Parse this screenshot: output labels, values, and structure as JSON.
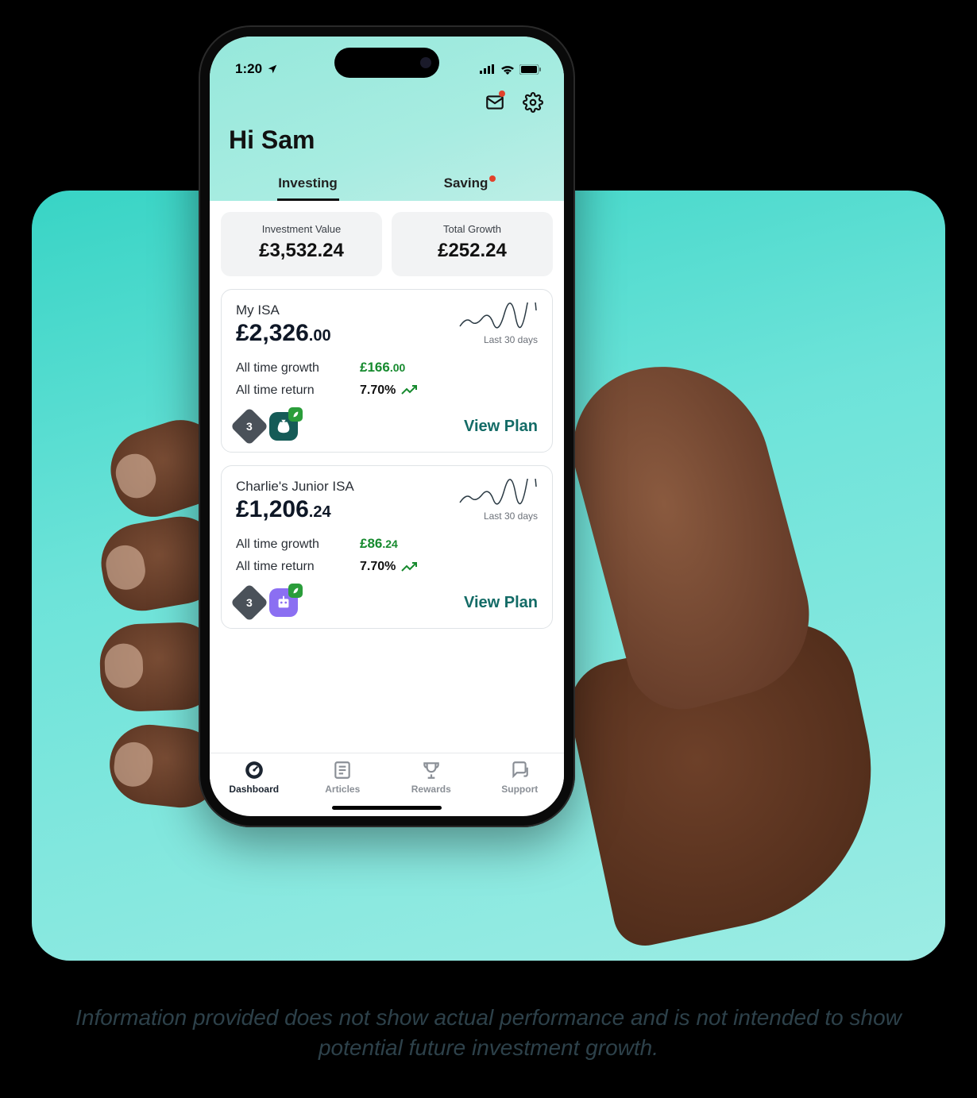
{
  "status": {
    "time": "1:20"
  },
  "greeting": "Hi Sam",
  "tabs": {
    "investing": "Investing",
    "saving": "Saving"
  },
  "summary": {
    "value_label": "Investment Value",
    "value_amount": "£3,532.24",
    "growth_label": "Total Growth",
    "growth_amount": "£252.24"
  },
  "plans": [
    {
      "name": "My ISA",
      "balance_main": "£2,326",
      "balance_cents": ".00",
      "spark_label": "Last 30 days",
      "growth_label": "All time growth",
      "growth_main": "£166",
      "growth_cents": ".00",
      "return_label": "All time return",
      "return_value": "7.70%",
      "badge_number": "3",
      "view_label": "View Plan",
      "badge_color": "#155b57",
      "icon": "isa-bag"
    },
    {
      "name": "Charlie's Junior ISA",
      "balance_main": "£1,206",
      "balance_cents": ".24",
      "spark_label": "Last 30 days",
      "growth_label": "All time growth",
      "growth_main": "£86",
      "growth_cents": ".24",
      "return_label": "All time return",
      "return_value": "7.70%",
      "badge_number": "3",
      "view_label": "View Plan",
      "badge_color": "#8b6ff2",
      "icon": "robot"
    }
  ],
  "nav": {
    "dashboard": "Dashboard",
    "articles": "Articles",
    "rewards": "Rewards",
    "support": "Support"
  },
  "disclaimer": "Information provided does not show actual performance and is not intended to show potential future investment growth."
}
